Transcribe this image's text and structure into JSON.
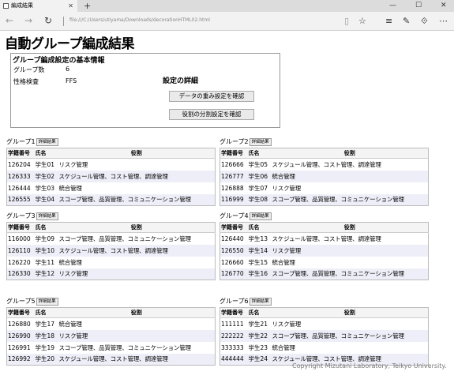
{
  "browser": {
    "tab_title": "編成結果",
    "new_tab": "+",
    "address": "file:///C:/Users/utiyama/Downloads/decorationHTML02.html",
    "minimize": "—",
    "maximize": "☐",
    "close": "✕"
  },
  "page": {
    "title": "自動グループ編成結果",
    "info": {
      "heading": "グループ編成設定の基本情報",
      "group_count_label": "グループ数",
      "group_count_value": "6",
      "personality_label": "性格検査",
      "personality_value": "FFS",
      "detail_heading": "設定の詳細",
      "weight_button": "データの重み設定を確認",
      "role_button": "役割の分割設定を確認"
    },
    "detail_button_label": "詳細結果",
    "columns": [
      "学籍番号",
      "氏名",
      "役割"
    ],
    "groups": [
      {
        "label": "グループ1",
        "rows": [
          [
            "126204",
            "学生01",
            "リスク管理"
          ],
          [
            "126333",
            "学生02",
            "スケジュール管理、コスト管理、調達管理"
          ],
          [
            "126444",
            "学生03",
            "統合管理"
          ],
          [
            "126555",
            "学生04",
            "スコープ管理、品質管理、コミュニケーション管理"
          ]
        ]
      },
      {
        "label": "グループ2",
        "rows": [
          [
            "126666",
            "学生05",
            "スケジュール管理、コスト管理、調達管理"
          ],
          [
            "126777",
            "学生06",
            "統合管理"
          ],
          [
            "126888",
            "学生07",
            "リスク管理"
          ],
          [
            "116999",
            "学生08",
            "スコープ管理、品質管理、コミュニケーション管理"
          ]
        ]
      },
      {
        "label": "グループ3",
        "rows": [
          [
            "116000",
            "学生09",
            "スコープ管理、品質管理、コミュニケーション管理"
          ],
          [
            "126110",
            "学生10",
            "スケジュール管理、コスト管理、調達管理"
          ],
          [
            "126220",
            "学生11",
            "統合管理"
          ],
          [
            "126330",
            "学生12",
            "リスク管理"
          ]
        ]
      },
      {
        "label": "グループ4",
        "rows": [
          [
            "126440",
            "学生13",
            "スケジュール管理、コスト管理、調達管理"
          ],
          [
            "126550",
            "学生14",
            "リスク管理"
          ],
          [
            "126660",
            "学生15",
            "統合管理"
          ],
          [
            "126770",
            "学生16",
            "スコープ管理、品質管理、コミュニケーション管理"
          ]
        ]
      },
      {
        "label": "グループ5",
        "rows": [
          [
            "126880",
            "学生17",
            "統合管理"
          ],
          [
            "126990",
            "学生18",
            "リスク管理"
          ],
          [
            "126991",
            "学生19",
            "スコープ管理、品質管理、コミュニケーション管理"
          ],
          [
            "126992",
            "学生20",
            "スケジュール管理、コスト管理、調達管理"
          ]
        ]
      },
      {
        "label": "グループ6",
        "rows": [
          [
            "111111",
            "学生21",
            "リスク管理"
          ],
          [
            "222222",
            "学生22",
            "スコープ管理、品質管理、コミュニケーション管理"
          ],
          [
            "333333",
            "学生23",
            "統合管理"
          ],
          [
            "444444",
            "学生24",
            "スケジュール管理、コスト管理、調達管理"
          ]
        ]
      }
    ],
    "copyright": "Copyright Mizutani Laboratory, Teikyo University."
  }
}
